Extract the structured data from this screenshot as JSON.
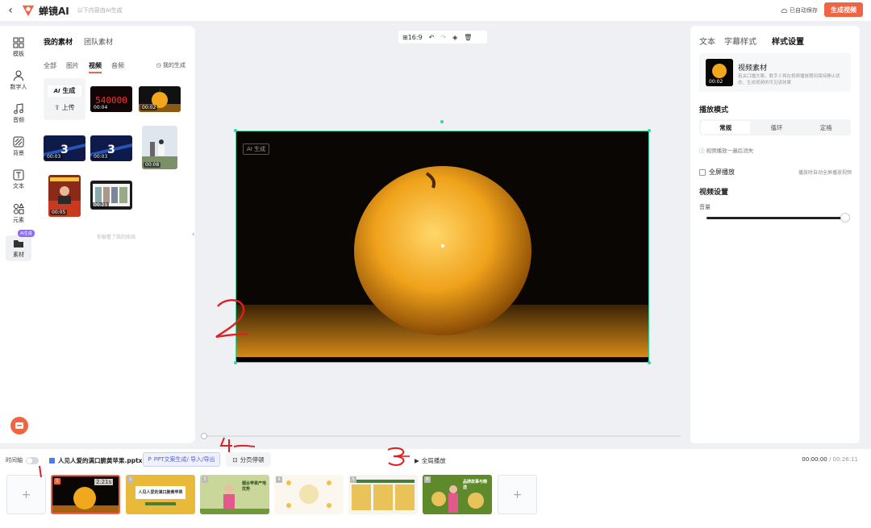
{
  "header": {
    "back": "‹",
    "brand": "蝉镜AI",
    "hint": "以下内容由AI生成",
    "autosave": "已自动保存",
    "generate": "生成视频"
  },
  "sidebar": {
    "items": [
      {
        "label": "模板",
        "icon": "template-icon"
      },
      {
        "label": "数字人",
        "icon": "person-icon"
      },
      {
        "label": "音频",
        "icon": "music-icon"
      },
      {
        "label": "背景",
        "icon": "background-icon"
      },
      {
        "label": "文本",
        "icon": "text-icon"
      },
      {
        "label": "元素",
        "icon": "shapes-icon"
      },
      {
        "label": "素材",
        "icon": "folder-icon"
      }
    ],
    "ai_tag": "AI生成"
  },
  "materials": {
    "tabs": [
      "我的素材",
      "团队素材"
    ],
    "filters": [
      "全部",
      "图片",
      "视频",
      "音频"
    ],
    "mine": "我的生成",
    "generate": "生成",
    "upload": "上传",
    "thumbs": [
      {
        "dur": "00:04",
        "kind": "counter",
        "text": "540000"
      },
      {
        "dur": "00:02",
        "kind": "apple"
      },
      {
        "dur": "00:03",
        "kind": "three"
      },
      {
        "dur": "00:03",
        "kind": "three"
      },
      {
        "dur": "00:08",
        "kind": "person"
      },
      {
        "dur": "00:05",
        "kind": "market"
      },
      {
        "dur": "00:21",
        "kind": "collage"
      }
    ],
    "end_note": "你被看了我的底线"
  },
  "canvas": {
    "ratio": "16:9",
    "ai_badge": "AI 生成"
  },
  "right": {
    "tabs": [
      "文本",
      "字幕样式",
      "样式设置"
    ],
    "video_title": "视频素材",
    "video_dur": "00:02",
    "video_desc": "若关口播文案，数字人将在视频播放期间保持静止状态，生成视频的可见该效果",
    "play_mode": "播放模式",
    "modes": [
      "常规",
      "循环",
      "定格"
    ],
    "mode_note": "视频播放一遍后消失",
    "fullscreen": "全屏播放",
    "fullscreen_note": "播放时自动全屏播放视频",
    "video_settings": "视频设置",
    "volume": "音量",
    "volume_level": 1.0
  },
  "timeline": {
    "label": "时间轴",
    "file": "人见人爱的满口脆黄苹果.pptx",
    "ppt_btn": "PPT文案生成/ 导入/导出",
    "page_btn": "分页停顿",
    "global_play": "全局播放",
    "time_cur": "00:00:00",
    "time_total": " / 00:26:11",
    "slide1_dur": "2.21s",
    "slides": [
      {
        "n": "1",
        "title": ""
      },
      {
        "n": "2",
        "title": "人见人爱的满口脆黄苹果"
      },
      {
        "n": "3",
        "title": "烟台苹果产地优势"
      },
      {
        "n": "4",
        "title": ""
      },
      {
        "n": "5",
        "title": ""
      },
      {
        "n": "6",
        "title": "品牌故事与精选"
      }
    ]
  },
  "annotations": [
    "1",
    "2",
    "3",
    "4"
  ]
}
